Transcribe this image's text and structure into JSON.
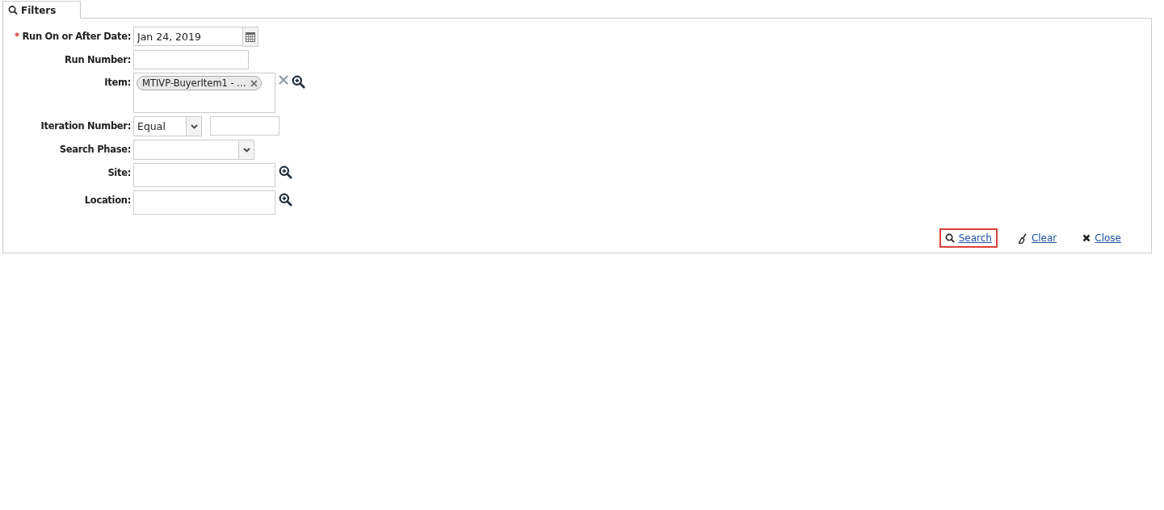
{
  "tab": {
    "label": "Filters",
    "selected": true
  },
  "fields": [
    {
      "kind": "date",
      "label": "Run On or After Date:",
      "required_mark": "*",
      "value": "Jan 24, 2019"
    },
    {
      "kind": "text",
      "label": "Run Number:"
    },
    {
      "kind": "tokens",
      "label": "Item:",
      "tokens": [
        "MTIVP-BuyerItem1 - ..."
      ]
    },
    {
      "kind": "compare",
      "label": "Iteration Number:",
      "value": "Equal"
    },
    {
      "kind": "select",
      "label": "Search Phase:"
    },
    {
      "kind": "lookup",
      "label": "Site:"
    },
    {
      "kind": "lookup",
      "label": "Location:"
    }
  ],
  "actions": [
    {
      "kind": "search",
      "label": "Search",
      "highlighted": true
    },
    {
      "kind": "clear",
      "label": "Clear",
      "highlighted": false
    },
    {
      "kind": "close",
      "label": "Close",
      "highlighted": false
    }
  ]
}
